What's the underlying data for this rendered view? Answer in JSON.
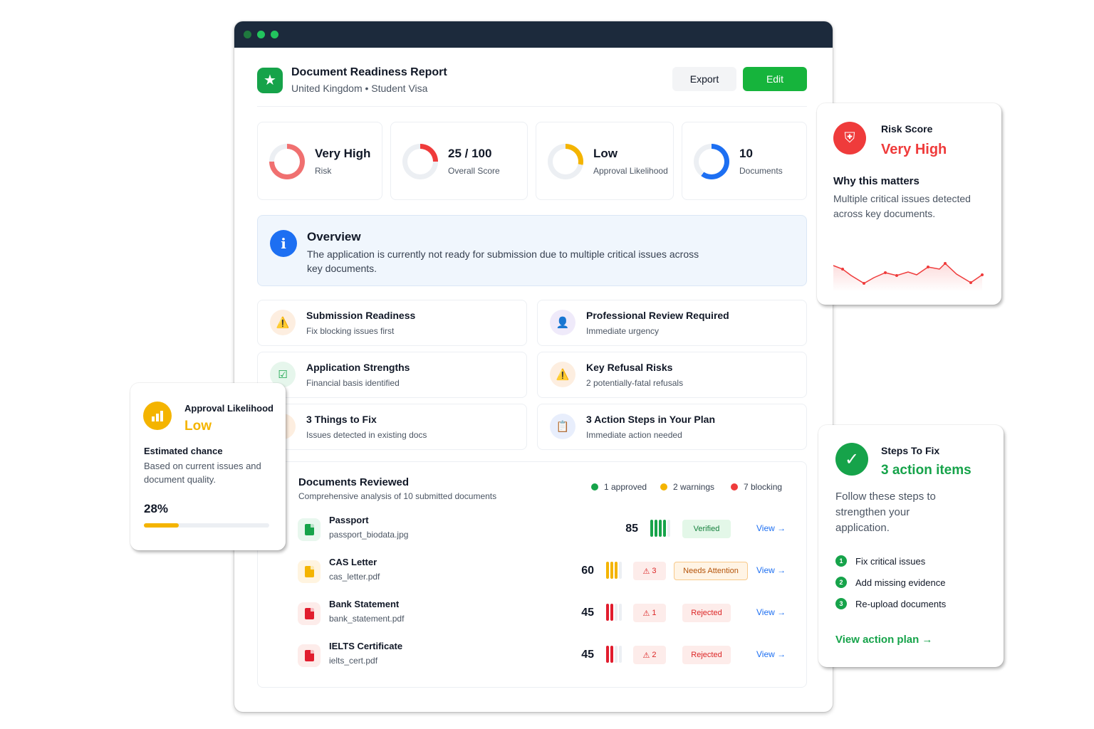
{
  "report": {
    "title": "Document Readiness Report",
    "subtitle": "United Kingdom • Student Visa",
    "export_label": "Export",
    "edit_label": "Edit"
  },
  "stats": [
    {
      "value": "Very High",
      "label": "Risk",
      "color": "#f07070",
      "progress": 0.75
    },
    {
      "value": "25 / 100",
      "label": "Overall Score",
      "color": "#ef3b3b",
      "progress": 0.25
    },
    {
      "value": "Low",
      "label": "Approval Likelihood",
      "color": "#f4b400",
      "progress": 0.28
    },
    {
      "value": "10",
      "label": "Documents",
      "color": "#1d6ff2",
      "progress": 0.6
    }
  ],
  "overview": {
    "title": "Overview",
    "text": "The application is currently not ready for submission due to multiple critical issues across key documents."
  },
  "info_cards": [
    {
      "title": "Submission Readiness",
      "subtitle": "Fix blocking issues first",
      "icon": "warning-icon"
    },
    {
      "title": "Professional Review Required",
      "subtitle": "Immediate urgency",
      "icon": "person-icon"
    },
    {
      "title": "Application Strengths",
      "subtitle": "Financial basis identified",
      "icon": "check-square-icon"
    },
    {
      "title": "Key Refusal Risks",
      "subtitle": "2 potentially-fatal refusals",
      "icon": "warning-icon"
    },
    {
      "title": "3 Things to Fix",
      "subtitle": "Issues detected in existing docs",
      "icon": "wrench-icon"
    },
    {
      "title": "3 Action Steps in Your Plan",
      "subtitle": "Immediate action needed",
      "icon": "clipboard-icon"
    }
  ],
  "documents": {
    "title": "Documents Reviewed",
    "subtitle": "Comprehensive analysis of 10 submitted documents",
    "legend": [
      {
        "label": "1 approved",
        "color": "#16a34a"
      },
      {
        "label": "2 warnings",
        "color": "#f4b400"
      },
      {
        "label": "7 blocking",
        "color": "#ef3b3b"
      }
    ],
    "view_label": "View →",
    "rows": [
      {
        "name": "Passport",
        "file": "passport_biodata.jpg",
        "score": "85",
        "filled_bars": 4,
        "bar_color": "#16a34a",
        "warnings": "",
        "status": "Verified",
        "status_bg": "#e3f7e8",
        "status_fg": "#15803d",
        "status_border": "#e3f7e8",
        "icon_bg": "#e8f7ee",
        "icon_fg": "#16a34a"
      },
      {
        "name": "CAS Letter",
        "file": "cas_letter.pdf",
        "score": "60",
        "filled_bars": 3,
        "bar_color": "#f4b400",
        "warnings": "3",
        "status": "Needs Attention",
        "status_bg": "#fff4e5",
        "status_fg": "#b45309",
        "status_border": "#f8c98a",
        "icon_bg": "#fff4e0",
        "icon_fg": "#f4b400"
      },
      {
        "name": "Bank Statement",
        "file": "bank_statement.pdf",
        "score": "45",
        "filled_bars": 2,
        "bar_color": "#e11d2e",
        "warnings": "1",
        "status": "Rejected",
        "status_bg": "#fdecea",
        "status_fg": "#dc2626",
        "status_border": "#fdecea",
        "icon_bg": "#fdecea",
        "icon_fg": "#e11d2e"
      },
      {
        "name": "IELTS Certificate",
        "file": "ielts_cert.pdf",
        "score": "45",
        "filled_bars": 2,
        "bar_color": "#e11d2e",
        "warnings": "2",
        "status": "Rejected",
        "status_bg": "#fdecea",
        "status_fg": "#dc2626",
        "status_border": "#fdecea",
        "icon_bg": "#fdecea",
        "icon_fg": "#e11d2e"
      }
    ]
  },
  "risk_card": {
    "label": "Risk Score",
    "value": "Very High",
    "heading": "Why this matters",
    "text": "Multiple critical issues detected across key documents.",
    "accent": "#ef3b3b"
  },
  "approval_card": {
    "label": "Approval Likelihood",
    "value": "Low",
    "heading": "Estimated chance",
    "text": "Based on current issues and document quality.",
    "percent_text": "28%",
    "progress": 0.28,
    "accent": "#f4b400"
  },
  "steps_card": {
    "label": "Steps To Fix",
    "value": "3 action items",
    "text": "Follow these steps to strengthen your application.",
    "steps": [
      "Fix critical issues",
      "Add missing evidence",
      "Re-upload documents"
    ],
    "link": "View action plan →",
    "accent": "#16a34a"
  }
}
